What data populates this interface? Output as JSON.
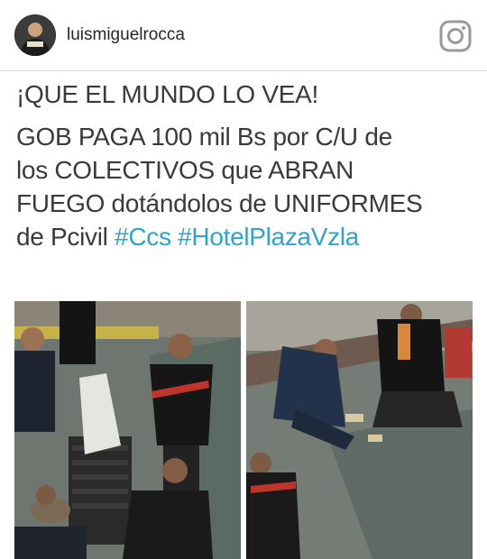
{
  "post": {
    "username": "luismiguelrocca",
    "avatar_icon": "user-avatar",
    "brand_icon": "instagram-icon",
    "caption": {
      "headline": "¡QUE EL MUNDO LO VEA!",
      "lines": [
        "GOB PAGA 100 mil Bs por C/U de",
        "los COLECTIVOS que ABRAN",
        "FUEGO dotándolos de UNIFORMES"
      ],
      "last_line_text": "de Pcivil ",
      "hashtags": [
        "#Ccs",
        "#HotelPlazaVzla"
      ]
    },
    "photos": [
      "left-photo",
      "right-photo"
    ]
  },
  "colors": {
    "text": "#3a3a3a",
    "hashtag": "#2fa4c8",
    "username": "#262626",
    "divider": "#d9d9d9"
  }
}
